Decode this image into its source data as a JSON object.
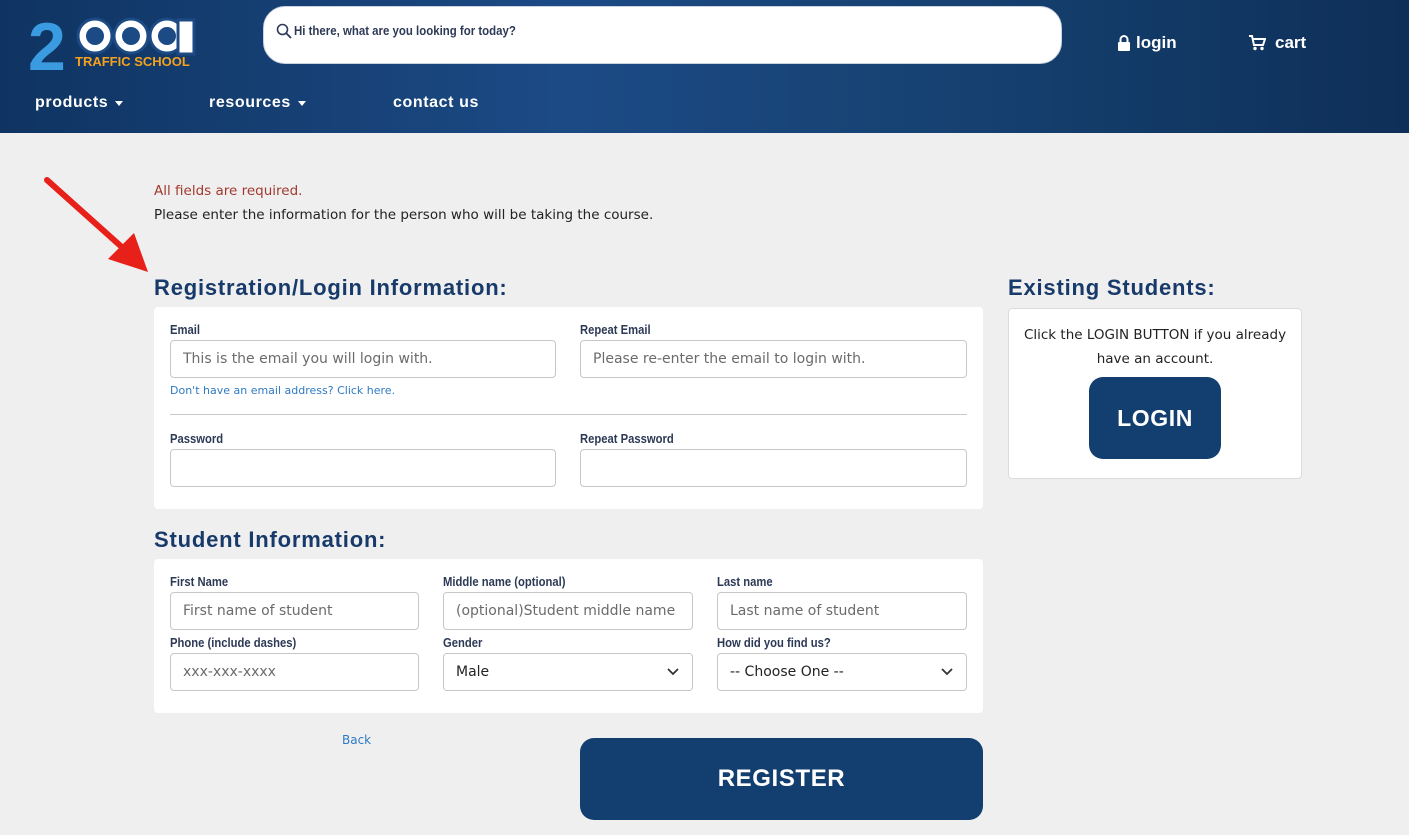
{
  "header": {
    "logo": {
      "big": "2COOL",
      "sub": "TRAFFIC SCHOOL"
    },
    "search_placeholder": "Hi there, what are you looking for today?",
    "login_label": "login",
    "cart_label": "cart",
    "nav": {
      "products": "products",
      "resources": "resources",
      "contact": "contact us"
    }
  },
  "notice": {
    "required": "All fields are required.",
    "intro": "Please enter the information for the person who will be taking the course."
  },
  "registration": {
    "title": "Registration/Login Information:",
    "email_label": "Email",
    "email_placeholder": "This is the email you will login with.",
    "repeat_email_label": "Repeat Email",
    "repeat_email_placeholder": "Please re-enter the email to login with.",
    "no_email_link": "Don't have an email address? Click here.",
    "password_label": "Password",
    "repeat_password_label": "Repeat Password"
  },
  "student": {
    "title": "Student Information:",
    "first_label": "First Name",
    "first_placeholder": "First name of student",
    "middle_label": "Middle name (optional)",
    "middle_placeholder": "(optional)Student middle name",
    "last_label": "Last name",
    "last_placeholder": "Last name of student",
    "phone_label": "Phone (include dashes)",
    "phone_placeholder": "xxx-xxx-xxxx",
    "gender_label": "Gender",
    "gender_value": "Male",
    "find_label": "How did you find us?",
    "find_value": "-- Choose One --"
  },
  "actions": {
    "back": "Back",
    "register": "REGISTER"
  },
  "existing": {
    "title": "Existing Students:",
    "text": "Click the LOGIN BUTTON if you already have an account.",
    "login_button": "LOGIN"
  },
  "colors": {
    "navy": "#123e70",
    "header_blue": "#1c4a85",
    "logo_blue": "#3b9be0",
    "logo_orange": "#f4a21d",
    "error_red": "#a33a2e",
    "arrow_red": "#e8201a"
  }
}
